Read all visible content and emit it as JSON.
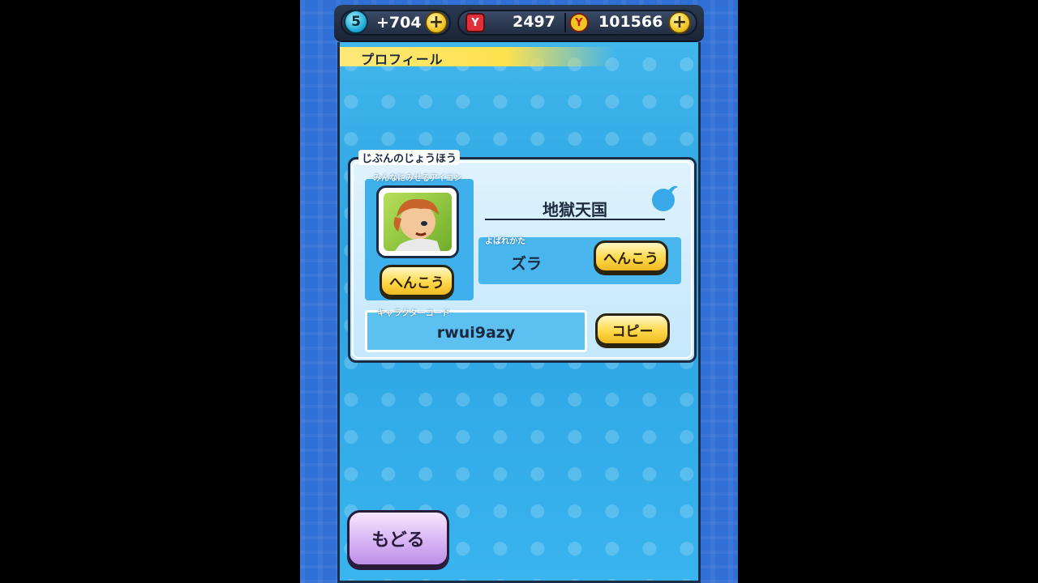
{
  "topbar": {
    "level": "5",
    "energy": "+704",
    "plus_symbol": "+",
    "ticket_count": "2497",
    "money": "101566"
  },
  "section": {
    "title": "プロフィール"
  },
  "card": {
    "title": "じぶんのじょうほう",
    "icon_label": "みんなにみせるアイコン",
    "icon_change_label": "へんこう",
    "player_name": "地獄天国",
    "nickname_label": "よばれかた",
    "nickname_value": "ズラ",
    "nickname_change_label": "へんこう",
    "code_label": "キャラクターコード",
    "code_value": "rwui9azy",
    "copy_label": "コピー"
  },
  "footer": {
    "back_label": "もどる"
  },
  "colors": {
    "accent_yellow": "#ffd94a",
    "panel_blue": "#2aa3e2",
    "back_purple": "#d7b5f4"
  }
}
